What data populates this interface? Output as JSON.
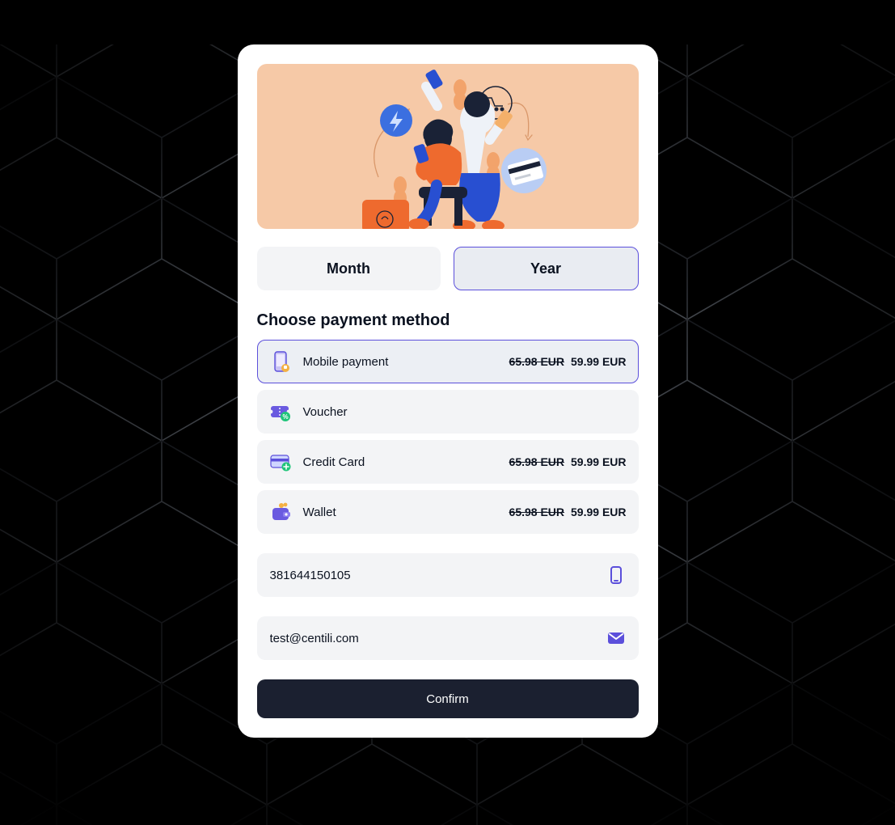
{
  "colors": {
    "accent": "#5b4fdb",
    "hero_bg": "#f6c9a7",
    "orange": "#ee6a2e",
    "blue": "#284fd1",
    "dark": "#1a2236",
    "confirm_bg": "#1b2030"
  },
  "tabs": {
    "month": {
      "label": "Month",
      "active": false
    },
    "year": {
      "label": "Year",
      "active": true
    }
  },
  "section_title": "Choose payment method",
  "methods": [
    {
      "id": "mobile",
      "label": "Mobile payment",
      "price_old": "65.98 EUR",
      "price_new": "59.99 EUR",
      "selected": true,
      "icon": "mobile-payment-icon"
    },
    {
      "id": "voucher",
      "label": "Voucher",
      "price_old": "",
      "price_new": "",
      "selected": false,
      "icon": "voucher-icon"
    },
    {
      "id": "card",
      "label": "Credit Card",
      "price_old": "65.98 EUR",
      "price_new": "59.99 EUR",
      "selected": false,
      "icon": "credit-card-icon"
    },
    {
      "id": "wallet",
      "label": "Wallet",
      "price_old": "65.98 EUR",
      "price_new": "59.99 EUR",
      "selected": false,
      "icon": "wallet-icon"
    }
  ],
  "fields": {
    "phone": {
      "value": "381644150105",
      "placeholder": "Phone number"
    },
    "email": {
      "value": "test@centili.com",
      "placeholder": "Email"
    }
  },
  "confirm_label": "Confirm"
}
